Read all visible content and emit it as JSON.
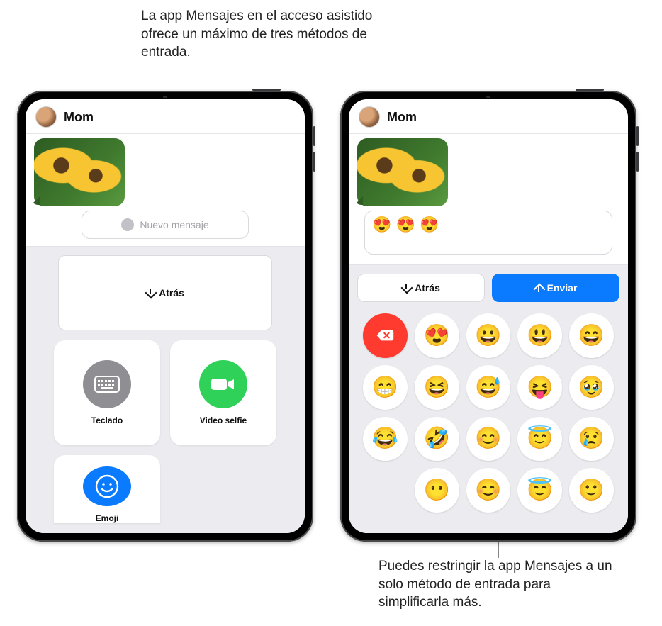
{
  "callouts": {
    "top": "La app Mensajes en el acceso asistido ofrece un máximo de tres métodos de entrada.",
    "bottom": "Puedes restringir la app Mensajes a un solo método de entrada para simplificarla más."
  },
  "left_ipad": {
    "contact": "Mom",
    "compose_placeholder": "Nuevo mensaje",
    "back_label": "Atrás",
    "tiles": {
      "keyboard": "Teclado",
      "video_selfie": "Video selfie",
      "emoji": "Emoji"
    }
  },
  "right_ipad": {
    "contact": "Mom",
    "compose_value": "😍 😍 😍",
    "back_label": "Atrás",
    "send_label": "Enviar",
    "emoji_keys": [
      [
        "__DEL__",
        "😍",
        "😀",
        "😃",
        "😄"
      ],
      [
        "😁",
        "😆",
        "😅",
        "😝",
        "🥹"
      ],
      [
        "😂",
        "🤣",
        "😊",
        "😇",
        "😢"
      ],
      [
        "__EMPTY__",
        "😶",
        "😊",
        "😇",
        "🙂"
      ]
    ]
  }
}
